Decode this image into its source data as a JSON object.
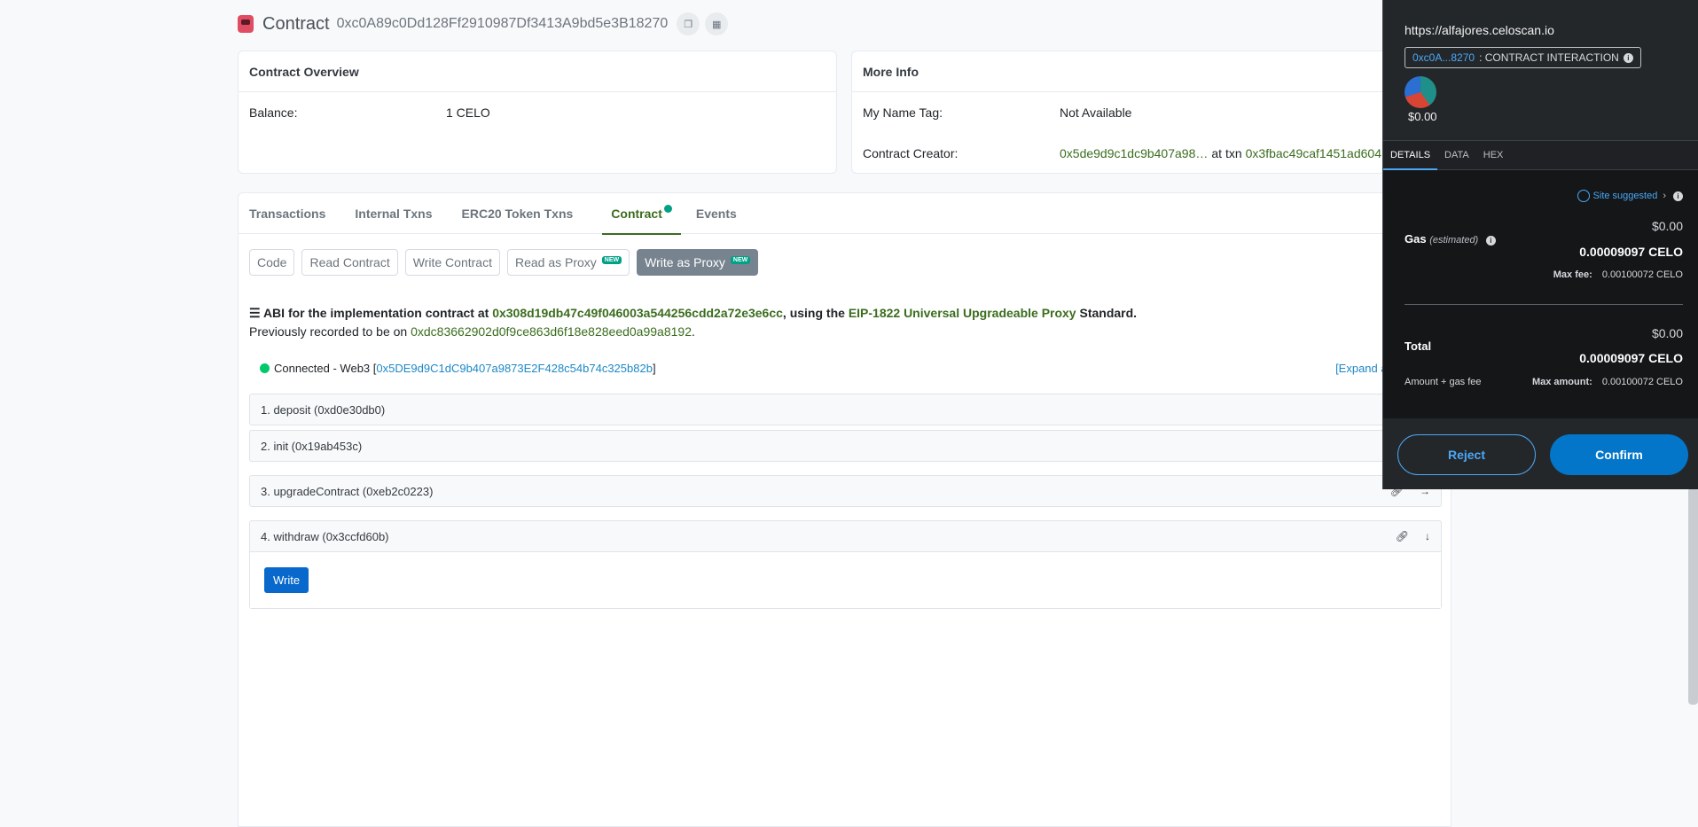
{
  "header": {
    "title": "Contract",
    "address": "0xc0A89c0Dd128Ff2910987Df3413A9bd5e3B18270"
  },
  "overview": {
    "heading": "Contract Overview",
    "balance_label": "Balance:",
    "balance_value": "1 CELO"
  },
  "moreinfo": {
    "heading": "More Info",
    "nametag_label": "My Name Tag:",
    "nametag_value": "Not Available",
    "creator_label": "Contract Creator:",
    "creator_addr": "0x5de9d9c1dc9b407a98…",
    "at_txn": "at txn",
    "txn": "0x3fbac49caf1451ad604"
  },
  "tabs": [
    "Transactions",
    "Internal Txns",
    "ERC20 Token Txns",
    "Contract",
    "Events"
  ],
  "subtabs": {
    "code": "Code",
    "read": "Read Contract",
    "write": "Write Contract",
    "read_proxy": "Read as Proxy",
    "write_proxy": "Write as Proxy",
    "badge": "NEW"
  },
  "abi": {
    "prefix": "ABI for the implementation contract at",
    "impl": "0x308d19db47c49f046003a544256cdd2a72e3e6cc",
    "using": ", using the",
    "standard_link": "EIP-1822 Universal Upgradeable Proxy",
    "standard": "Standard.",
    "prev": "Previously recorded to be on",
    "prev_addr": "0xdc83662902d0f9ce863d6f18e828eed0a99a8192",
    "period": "."
  },
  "connection": {
    "text": "Connected - Web3 [",
    "addr": "0x5DE9d9C1dC9b407a9873E2F428c54b74c325b82b",
    "close": "]",
    "expand": "[Expand all]"
  },
  "functions": [
    {
      "label": "1. deposit (0xd0e30db0)"
    },
    {
      "label": "2. init (0x19ab453c)"
    },
    {
      "label": "3. upgradeContract (0xeb2c0223)"
    },
    {
      "label": "4. withdraw (0x3ccfd60b)",
      "button": "Write"
    }
  ],
  "wallet": {
    "origin": "https://alfajores.celoscan.io",
    "chip_addr": "0xc0A...8270",
    "chip_text": ": CONTRACT INTERACTION",
    "balance": "$0.00",
    "tabs": [
      "DETAILS",
      "DATA",
      "HEX"
    ],
    "site_suggested": "Site suggested",
    "gas_label": "Gas",
    "gas_estimated": "(estimated)",
    "gas_usd": "$0.00",
    "gas_celo": "0.00009097 CELO",
    "maxfee_label": "Max fee:",
    "maxfee_value": "0.00100072 CELO",
    "total_label": "Total",
    "total_usd": "$0.00",
    "total_celo": "0.00009097 CELO",
    "amount_gas": "Amount + gas fee",
    "maxamount_label": "Max amount:",
    "maxamount_value": "0.00100072 CELO",
    "reject": "Reject",
    "confirm": "Confirm"
  }
}
